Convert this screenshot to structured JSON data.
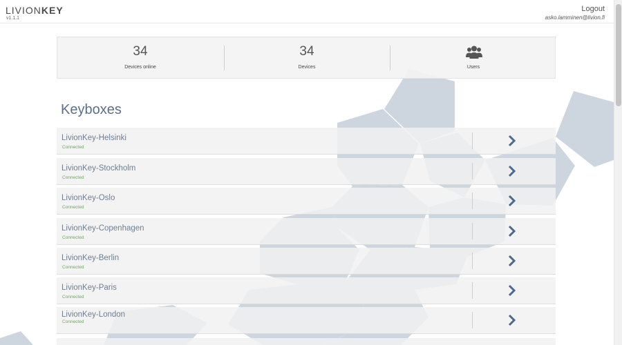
{
  "app": {
    "brand_part1": "LIVION",
    "brand_part2": "KEY",
    "version": "v1.1.1"
  },
  "user": {
    "logout_label": "Logout",
    "email": "asko.lamminen@livion.fi"
  },
  "stats": [
    {
      "value": "34",
      "label": "Devices online"
    },
    {
      "value": "34",
      "label": "Devices"
    },
    {
      "icon": "users-icon",
      "label": "Users"
    }
  ],
  "section_title": "Keyboxes",
  "keyboxes": [
    {
      "name": "LivionKey-Helsinki",
      "status": "Connected"
    },
    {
      "name": "LivionKey-Stockholm",
      "status": "Connected"
    },
    {
      "name": "LivionKey-Oslo",
      "status": "Connected"
    },
    {
      "name": "LivionKey-Copenhagen",
      "status": "Connected"
    },
    {
      "name": "LivionKey-Berlin",
      "status": "Connected"
    },
    {
      "name": "LivionKey-Paris",
      "status": "Connected"
    },
    {
      "name": "LivionKey-London",
      "status": "Connected"
    }
  ],
  "colors": {
    "accent": "#5c6f87",
    "status_connected": "#6ea564",
    "arrow": "#4d6a8e",
    "background_shape": "#cdd6df"
  }
}
